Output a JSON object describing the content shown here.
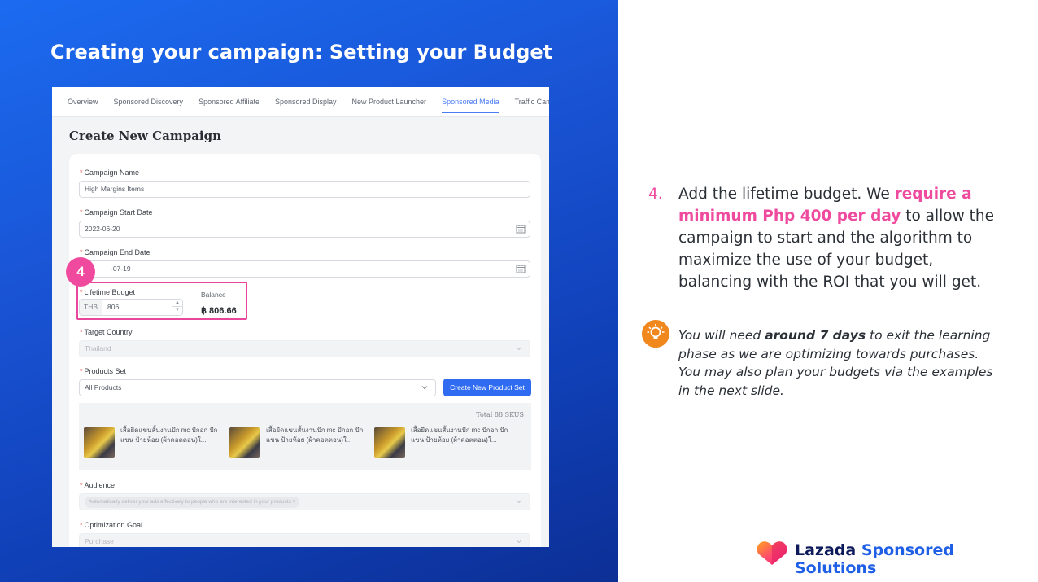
{
  "slide": {
    "title": "Creating your campaign: Setting your Budget"
  },
  "ui": {
    "tabs": [
      "Overview",
      "Sponsored Discovery",
      "Sponsored Affiliate",
      "Sponsored Display",
      "New Product Launcher",
      "Sponsored Media",
      "Traffic Campaign"
    ],
    "active_tab": "Sponsored Media",
    "page_title": "Create New Campaign",
    "campaign_name": {
      "label": "Campaign Name",
      "value": "High Margins Items"
    },
    "start_date": {
      "label": "Campaign Start Date",
      "value": "2022-06-20"
    },
    "end_date": {
      "label": "Campaign End Date",
      "value": "2022-07-19",
      "visible_value": "-07-19"
    },
    "lifetime_budget": {
      "label": "Lifetime Budget",
      "currency": "THB",
      "value": "806"
    },
    "balance": {
      "label": "Balance",
      "value": "฿ 806.66"
    },
    "target_country": {
      "label": "Target Country",
      "value": "Thailand"
    },
    "products_set": {
      "label": "Products Set",
      "value": "All Products",
      "create_button": "Create New Product Set"
    },
    "total_skus": "Total 88 SKUS",
    "products": [
      {
        "name": "เสื้อยืดแขนสั้นงานปัก mc ปักอก ปักแขน ป้ายห้อย (ผ้าคอตตอน)ใ..."
      },
      {
        "name": "เสื้อยืดแขนสั้นงานปัก mc ปักอก ปักแขน ป้ายห้อย (ผ้าคอตตอน)ใ..."
      },
      {
        "name": "เสื้อยืดแขนสั้นงานปัก mc ปักอก ปักแขน ป้ายห้อย (ผ้าคอตตอน)ใ..."
      }
    ],
    "audience": {
      "label": "Audience",
      "chip": "Automatically deliver your ads effectively to people who are interested in your products"
    },
    "optimization_goal": {
      "label": "Optimization Goal",
      "value": "Purchase"
    },
    "step_badge": "4"
  },
  "instruction": {
    "number": "4.",
    "text_before": "Add the lifetime budget. We ",
    "highlight": "require a minimum Php 400 per day",
    "text_after": " to allow the campaign to start and the algorithm to maximize the use of your budget, balancing with the ROI that you will get."
  },
  "tip": {
    "before": "You will need ",
    "bold": "around 7 days",
    "after": " to exit the learning phase as we are optimizing towards purchases. You may also plan your budgets via the examples in the next slide."
  },
  "brand": {
    "name_part1": "Lazada",
    "name_part2": " Sponsored Solutions"
  },
  "colors": {
    "accent_pink": "#ef4a9e",
    "primary_blue": "#2f6cf2",
    "tip_orange": "#f0881e"
  }
}
